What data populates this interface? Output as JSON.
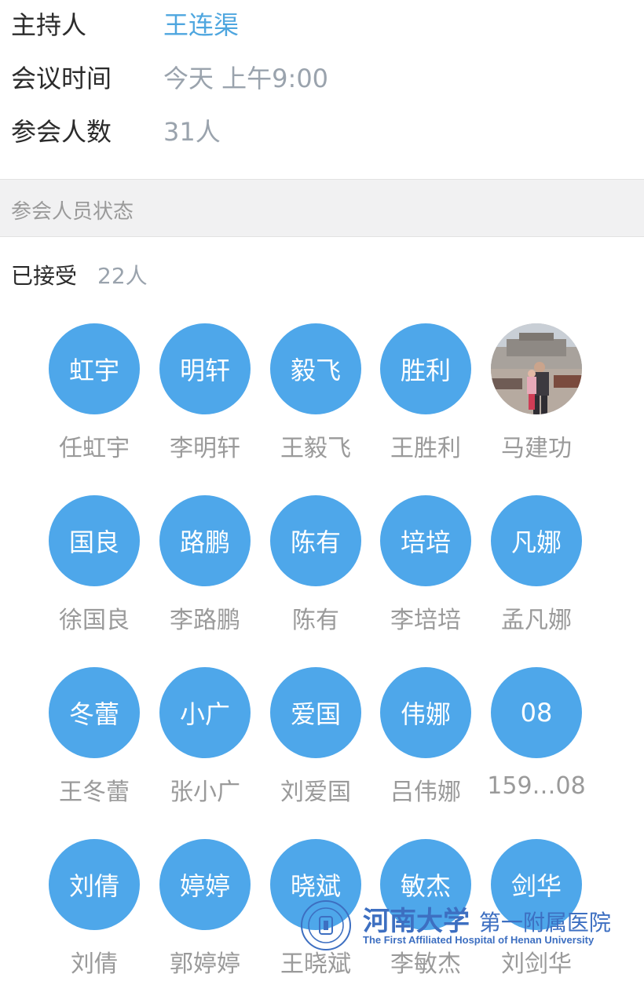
{
  "meeting": {
    "host_label": "主持人",
    "host_value": "王连渠",
    "time_label": "会议时间",
    "time_value": "今天 上午9:00",
    "attendees_label": "参会人数",
    "attendees_value": "31人"
  },
  "section": {
    "title": "参会人员状态"
  },
  "accepted": {
    "label": "已接受",
    "count": "22人"
  },
  "colors": {
    "accent": "#4ea7ea",
    "host_text": "#4ea6df",
    "muted_text": "#9a9a9a",
    "watermark": "#3d6fc1"
  },
  "members": [
    {
      "avatar": "虹宇",
      "name": "任虹宇"
    },
    {
      "avatar": "明轩",
      "name": "李明轩"
    },
    {
      "avatar": "毅飞",
      "name": "王毅飞"
    },
    {
      "avatar": "胜利",
      "name": "王胜利"
    },
    {
      "avatar": "",
      "name": "马建功",
      "photo": true
    },
    {
      "avatar": "国良",
      "name": "徐国良"
    },
    {
      "avatar": "路鹏",
      "name": "李路鹏"
    },
    {
      "avatar": "陈有",
      "name": "陈有"
    },
    {
      "avatar": "培培",
      "name": "李培培"
    },
    {
      "avatar": "凡娜",
      "name": "孟凡娜"
    },
    {
      "avatar": "冬蕾",
      "name": "王冬蕾"
    },
    {
      "avatar": "小广",
      "name": "张小广"
    },
    {
      "avatar": "爱国",
      "name": "刘爱国"
    },
    {
      "avatar": "伟娜",
      "name": "吕伟娜"
    },
    {
      "avatar": "08",
      "name": "159…08"
    },
    {
      "avatar": "刘倩",
      "name": "刘倩"
    },
    {
      "avatar": "婷婷",
      "name": "郭婷婷"
    },
    {
      "avatar": "晓斌",
      "name": "王晓斌"
    },
    {
      "avatar": "敏杰",
      "name": "李敏杰"
    },
    {
      "avatar": "剑华",
      "name": "刘剑华"
    }
  ],
  "watermark": {
    "cn_main": "河南大学",
    "cn_sub": "第一附属医院",
    "en": "The First Affiliated Hospital of Henan University"
  }
}
